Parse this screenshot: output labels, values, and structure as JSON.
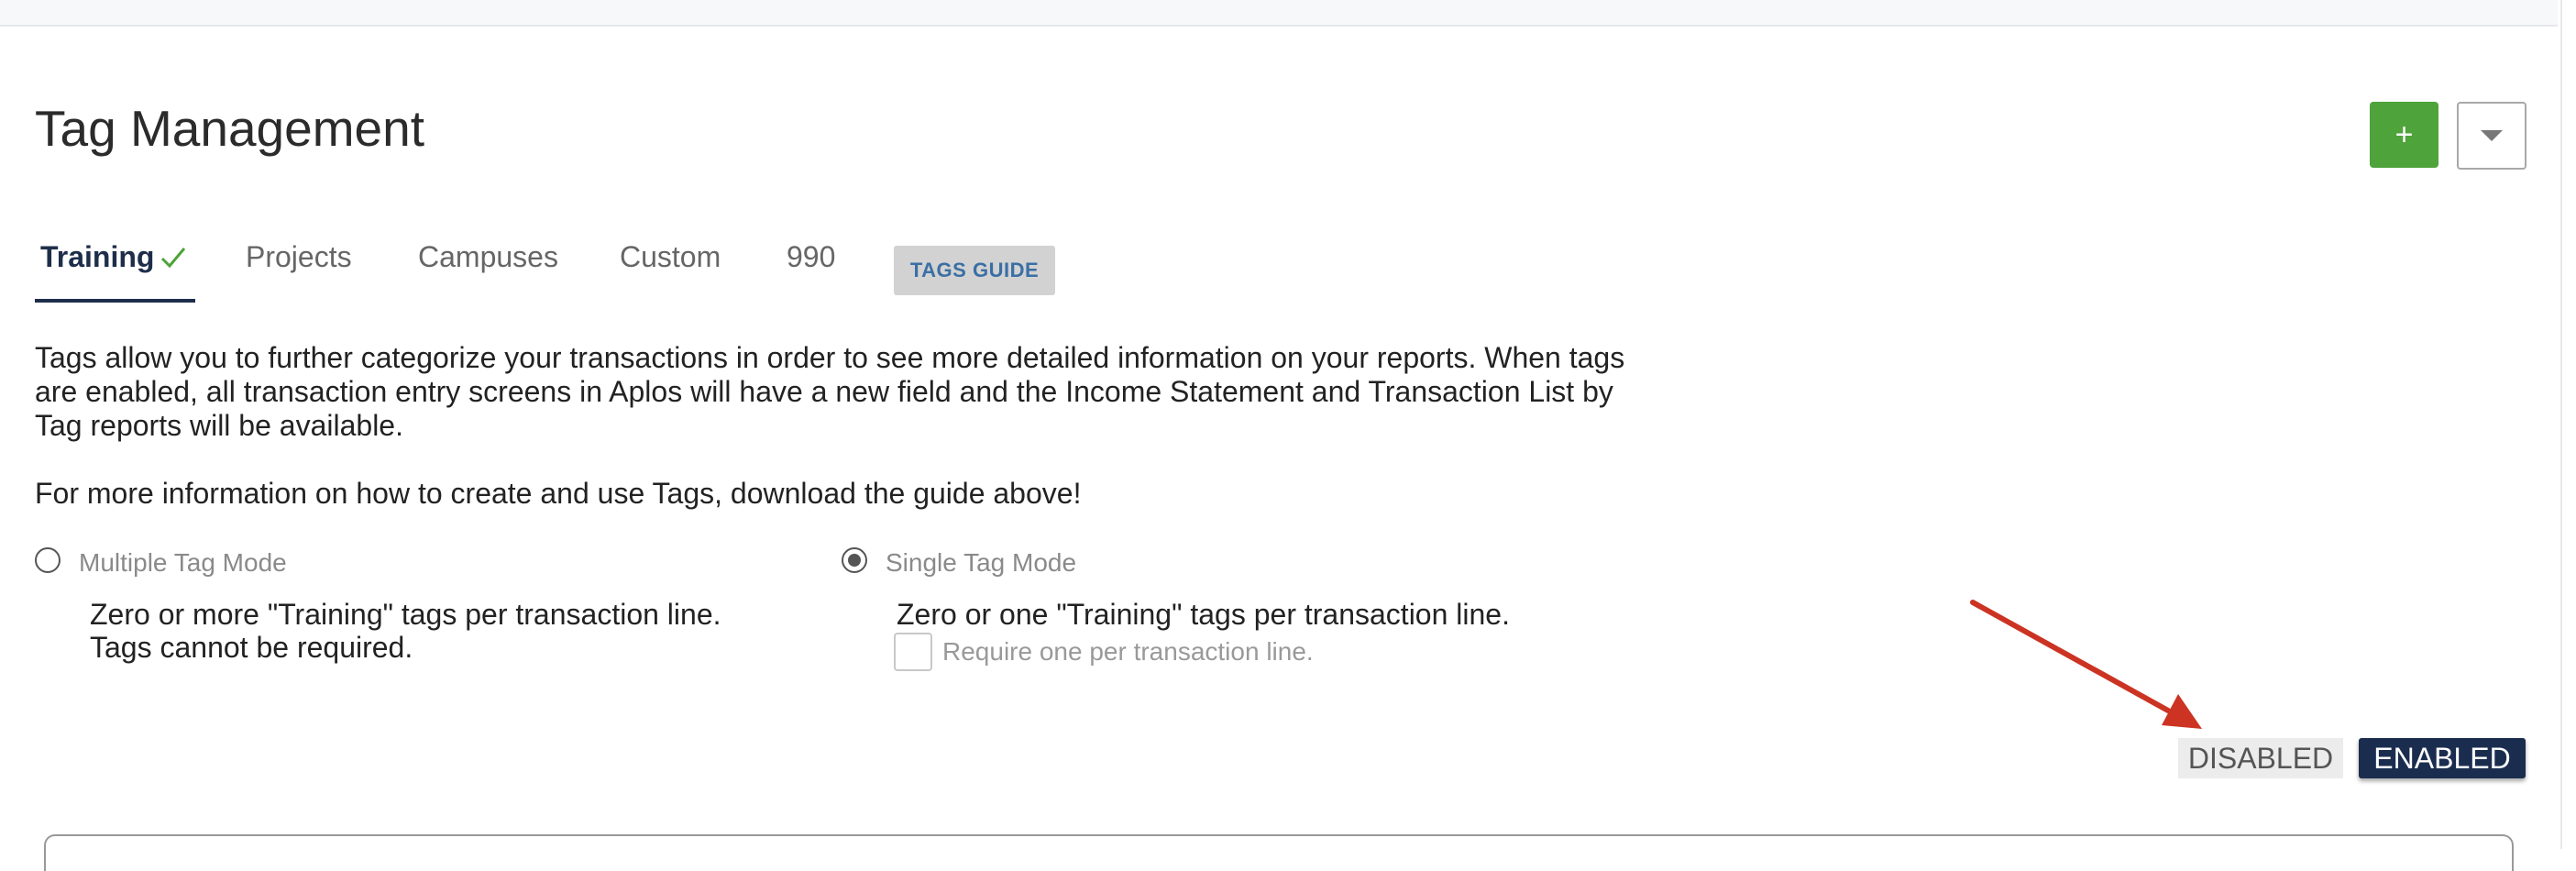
{
  "header": {
    "title": "Tag Management",
    "add_label": "+"
  },
  "tabs": [
    {
      "label": "Training",
      "active": true,
      "checked": true
    },
    {
      "label": "Projects",
      "active": false
    },
    {
      "label": "Campuses",
      "active": false
    },
    {
      "label": "Custom",
      "active": false
    },
    {
      "label": "990",
      "active": false
    }
  ],
  "guide_button": "TAGS GUIDE",
  "description": "Tags allow you to further categorize your transactions in order to see more detailed information on your reports. When tags are enabled, all transaction entry screens in Aplos will have a new field and the Income Statement and Transaction List by Tag reports will be available.",
  "info": "For more information on how to create and use Tags, download the guide above!",
  "modes": {
    "multiple": {
      "label": "Multiple Tag Mode",
      "selected": false,
      "line1": "Zero or more \"Training\" tags per transaction line.",
      "line2": "Tags cannot be required."
    },
    "single": {
      "label": "Single Tag Mode",
      "selected": true,
      "line1": "Zero or one \"Training\" tags per transaction line.",
      "require_label": "Require one per transaction line.",
      "require_checked": false
    }
  },
  "toggle": {
    "disabled_label": "DISABLED",
    "enabled_label": "ENABLED",
    "state": "enabled"
  },
  "colors": {
    "accent_green": "#4ea33a",
    "navy": "#1b2d4f",
    "arrow_red": "#cc3322",
    "guide_text": "#3a6fa5"
  }
}
